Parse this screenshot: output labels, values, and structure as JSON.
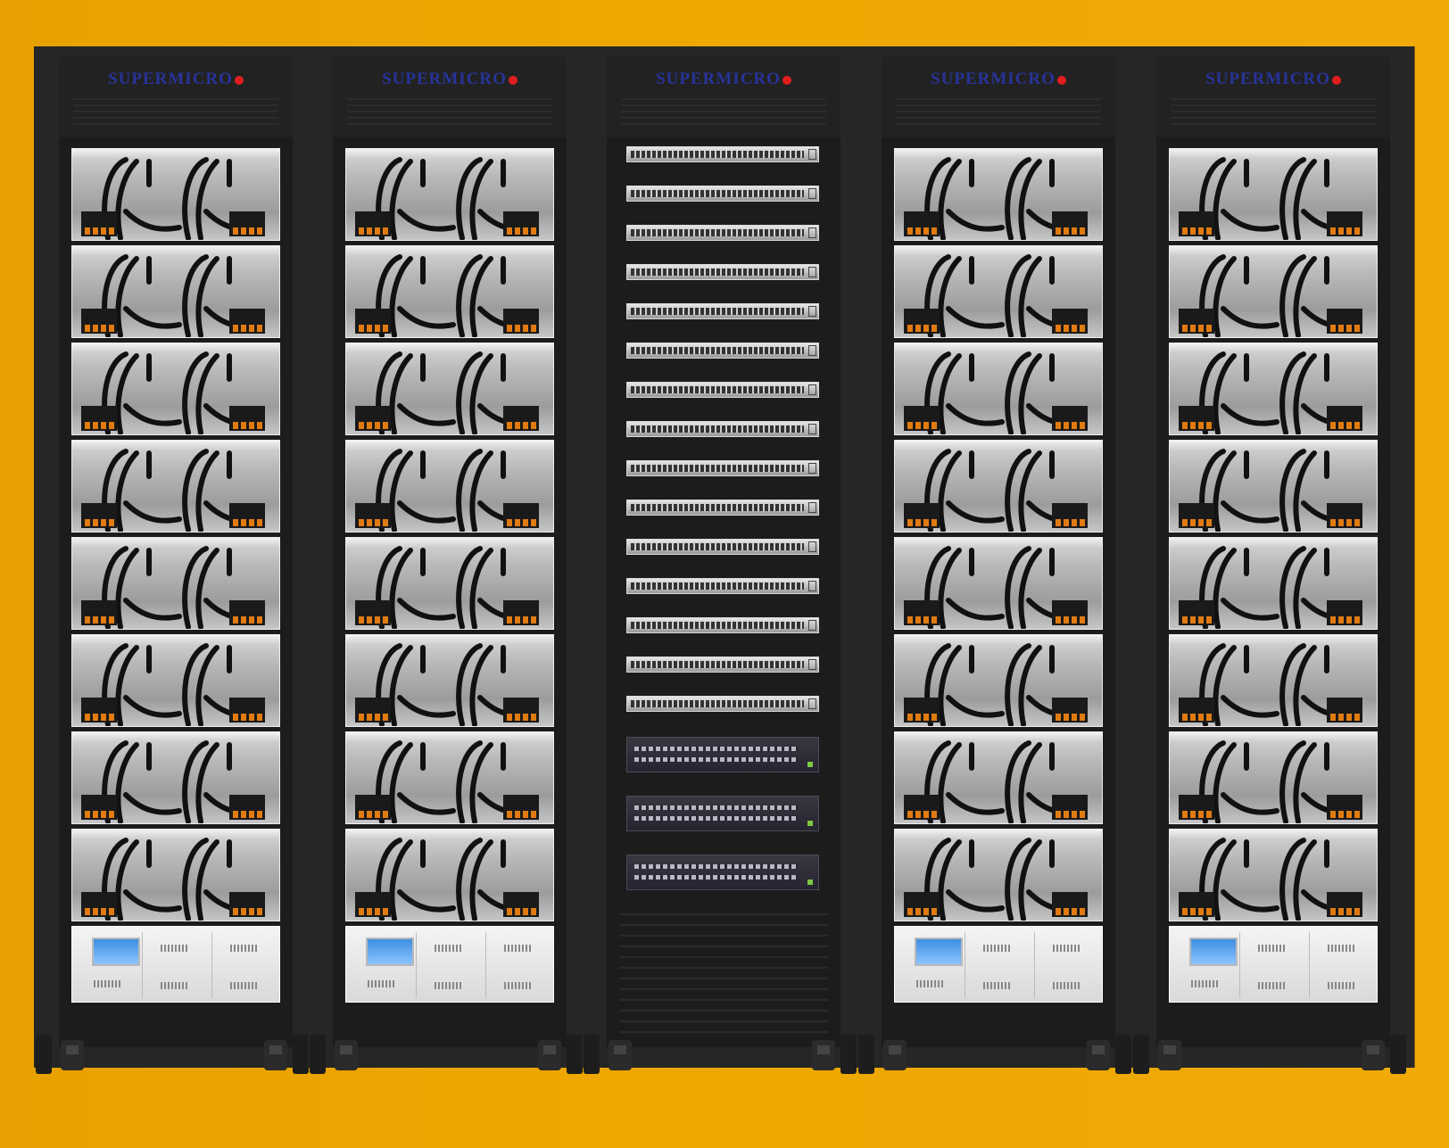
{
  "scene": {
    "background_color": "#eda700",
    "rack_color": "#262626",
    "description_label": ""
  },
  "racks": [
    {
      "type": "server",
      "logo": "SUPERMICRO",
      "servers": 8,
      "has_psu": true
    },
    {
      "type": "server",
      "logo": "SUPERMICRO",
      "servers": 8,
      "has_psu": true
    },
    {
      "type": "network",
      "logo": "SUPERMICRO",
      "switches_light": 15,
      "switches_dark": 3,
      "has_psu": false
    },
    {
      "type": "server",
      "logo": "SUPERMICRO",
      "servers": 8,
      "has_psu": true
    },
    {
      "type": "server",
      "logo": "SUPERMICRO",
      "servers": 8,
      "has_psu": true
    }
  ],
  "colors": {
    "logo_text": "#27349a",
    "logo_dot": "#e01e1e",
    "psu_screen": "#3f8fe0",
    "switch_led": "#7ac943"
  }
}
